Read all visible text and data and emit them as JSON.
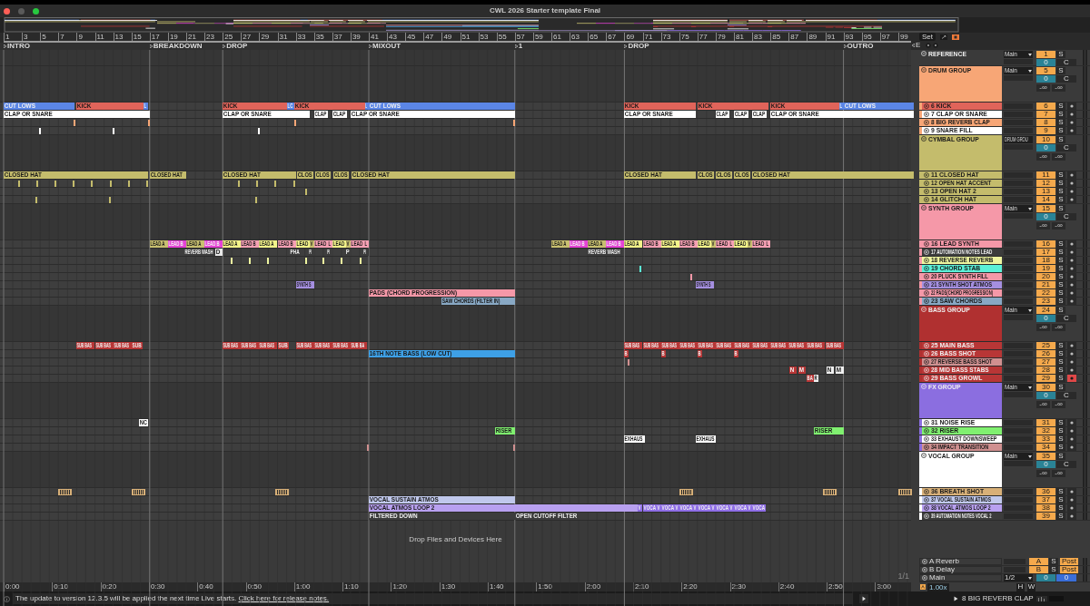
{
  "window": {
    "title": "CWL 2026 Starter template Final"
  },
  "ruler": {
    "bars": [
      "1",
      "3",
      "5",
      "7",
      "9",
      "11",
      "13",
      "15",
      "17",
      "19",
      "21",
      "23",
      "25",
      "27",
      "29",
      "31",
      "33",
      "35",
      "37",
      "39",
      "41",
      "43",
      "45",
      "47",
      "49",
      "51",
      "53",
      "55",
      "57",
      "59",
      "61",
      "63",
      "65",
      "67",
      "69",
      "71",
      "73",
      "75",
      "77",
      "79",
      "81",
      "83",
      "85",
      "87",
      "89",
      "91",
      "93",
      "95",
      "97",
      "99"
    ]
  },
  "set_button": "Set",
  "end_marker": "E",
  "locators": [
    {
      "name": "INTRO"
    },
    {
      "name": "BREAKDOWN"
    },
    {
      "name": "DROP"
    },
    {
      "name": "MIXOUT"
    },
    {
      "name": "1"
    },
    {
      "name": "DROP"
    },
    {
      "name": "OUTRO"
    }
  ],
  "tracks": [
    {
      "kind": "reference",
      "name": "REFERENCE",
      "number": "1",
      "solo": "S",
      "routing": "Main",
      "volume": "0",
      "pan": "C"
    },
    {
      "kind": "group",
      "name": "DRUM GROUP",
      "number": "5",
      "solo": "S",
      "routing": "Main",
      "volume": "0",
      "pan": "C",
      "meters": [
        "-∞",
        "-∞"
      ],
      "color": "#f7a676",
      "children": [
        {
          "kind": "track",
          "name": "6 KICK",
          "number": "6",
          "solo": "S",
          "armed": false,
          "color": "#e0645a",
          "clips": [
            {
              "name": "CUT LOWS",
              "color": "#5b86e6"
            },
            {
              "name": "KICK"
            },
            {
              "name": "L",
              "color": "#5b86e6"
            },
            {
              "name": "KICK"
            },
            {
              "name": "LC",
              "color": "#5b86e6"
            },
            {
              "name": "KICK"
            },
            {
              "name": "L",
              "color": "#5b86e6"
            },
            {
              "name": "CUT LOWS",
              "color": "#5b86e6"
            },
            {
              "name": "KICK"
            },
            {
              "name": "KICK"
            },
            {
              "name": "KICK"
            },
            {
              "name": "L",
              "color": "#5b86e6"
            },
            {
              "name": "CUT LOWS",
              "color": "#5b86e6"
            }
          ]
        },
        {
          "kind": "track",
          "name": "7 CLAP OR SNARE",
          "number": "7",
          "solo": "S",
          "armed": false,
          "color": "#ffffff",
          "clips": [
            {
              "name": "CLAP OR SNARE"
            },
            {
              "name": "CLAP OR SNARE"
            },
            {
              "name": "CLAP"
            },
            {
              "name": "CLAP"
            },
            {
              "name": "CLAP OR SNARE"
            },
            {
              "name": "CLAP OR SNARE"
            },
            {
              "name": "CLAP"
            },
            {
              "name": "CLAP"
            },
            {
              "name": "CLAP"
            },
            {
              "name": "CLAP OR SNARE"
            }
          ]
        },
        {
          "kind": "track",
          "name": "8 BIG REVERB CLAP",
          "number": "8",
          "solo": "S",
          "armed": false,
          "color": "#f7a676"
        },
        {
          "kind": "track",
          "name": "9 SNARE FILL",
          "number": "9",
          "solo": "S",
          "armed": false,
          "color": "#ffffff"
        }
      ]
    },
    {
      "kind": "group",
      "name": "CYMBAL GROUP",
      "number": "10",
      "solo": "S",
      "routing": "DRUM GROU",
      "volume": "0",
      "pan": "C",
      "meters": [
        "-∞",
        "-∞"
      ],
      "color": "#c4bc6c",
      "children": [
        {
          "kind": "track",
          "name": "11 CLOSED HAT",
          "number": "11",
          "solo": "S",
          "armed": false,
          "color": "#c4bc6c",
          "clips": [
            {
              "name": "CLOSED HAT"
            },
            {
              "name": "CLOSED HAT"
            },
            {
              "name": "CLOSED HAT"
            },
            {
              "name": "CLOS"
            },
            {
              "name": "CLOS"
            },
            {
              "name": "CLOS"
            },
            {
              "name": "CLOSED HAT"
            },
            {
              "name": "CLOSED HAT"
            },
            {
              "name": "CLOS"
            },
            {
              "name": "CLOS"
            },
            {
              "name": "CLOS"
            },
            {
              "name": "CLOSED HAT"
            }
          ]
        },
        {
          "kind": "track",
          "name": "12 OPEN HAT ACCENT",
          "number": "12",
          "solo": "S",
          "armed": false,
          "color": "#c4bc6c"
        },
        {
          "kind": "track",
          "name": "13 OPEN HAT 2",
          "number": "13",
          "solo": "S",
          "armed": false,
          "color": "#c4bc6c"
        },
        {
          "kind": "track",
          "name": "14 GLITCH HAT",
          "number": "14",
          "solo": "S",
          "armed": false,
          "color": "#c4bc6c"
        }
      ]
    },
    {
      "kind": "group",
      "name": "SYNTH GROUP",
      "number": "15",
      "solo": "S",
      "routing": "Main",
      "volume": "0",
      "pan": "C",
      "meters": [
        "-∞",
        "-∞"
      ],
      "color": "#f598a8",
      "children": [
        {
          "kind": "track",
          "name": "16 LEAD SYNTH",
          "number": "16",
          "solo": "S",
          "armed": false,
          "color": "#f598a8",
          "clips": [
            {
              "name": "LEAD A",
              "color": "#c8c070"
            },
            {
              "name": "LEAD B",
              "color": "#e543d6"
            },
            {
              "name": "LEAD A",
              "color": "#c8c070"
            },
            {
              "name": "LEAD B",
              "color": "#e543d6"
            },
            {
              "name": "LEAD A",
              "color": "#f3f48a"
            },
            {
              "name": "LEAD B",
              "color": "#f6a0b4"
            },
            {
              "name": "LEAD A",
              "color": "#f3f48a"
            },
            {
              "name": "LEAD B",
              "color": "#f6a0b4"
            },
            {
              "name": "LEAD",
              "color": "#f3f48a"
            },
            {
              "name": "V",
              "color": "#c8c070"
            },
            {
              "name": "LEAD",
              "color": "#f6a0b4"
            },
            {
              "name": "L",
              "color": "#f6a0b4"
            },
            {
              "name": "LEAD",
              "color": "#f3f48a"
            },
            {
              "name": "V",
              "color": "#c8c070"
            },
            {
              "name": "LEAD",
              "color": "#f6a0b4"
            },
            {
              "name": "L",
              "color": "#f6a0b4"
            },
            {
              "name": "LEAD A",
              "color": "#c8c070"
            },
            {
              "name": "LEAD B",
              "color": "#e543d6"
            },
            {
              "name": "LEAD A",
              "color": "#c8c070"
            },
            {
              "name": "LEAD B",
              "color": "#e543d6"
            },
            {
              "name": "LEAD A",
              "color": "#f3f48a"
            },
            {
              "name": "LEAD B",
              "color": "#f6a0b4"
            },
            {
              "name": "LEAD A",
              "color": "#f3f48a"
            },
            {
              "name": "LEAD B",
              "color": "#f6a0b4"
            },
            {
              "name": "LEAD",
              "color": "#f3f48a"
            },
            {
              "name": "V",
              "color": "#c8c070"
            },
            {
              "name": "LEAD",
              "color": "#f6a0b4"
            },
            {
              "name": "L",
              "color": "#f6a0b4"
            },
            {
              "name": "LEAD",
              "color": "#f3f48a"
            },
            {
              "name": "V",
              "color": "#c8c070"
            },
            {
              "name": "LEAD",
              "color": "#f6a0b4"
            },
            {
              "name": "L",
              "color": "#f6a0b4"
            }
          ]
        },
        {
          "kind": "track",
          "name": "17 AUTOMATION NOTES LEAD",
          "number": "17",
          "solo": "S",
          "armed": false,
          "color": "#3c3c3c",
          "clips": [
            {
              "name": "REVERB WASH"
            },
            {
              "name": "D",
              "color": "#e8e8e8"
            },
            {
              "name": "PHA"
            },
            {
              "name": "PI"
            },
            {
              "name": "PI"
            },
            {
              "name": "P"
            },
            {
              "name": "PI"
            },
            {
              "name": "REVERB WASH"
            }
          ]
        },
        {
          "kind": "track",
          "name": "18 REVERSE REVERB",
          "number": "18",
          "solo": "S",
          "armed": false,
          "color": "#eef5a0"
        },
        {
          "kind": "track",
          "name": "19 CHORD STAB",
          "number": "19",
          "solo": "S",
          "armed": false,
          "color": "#5af0d8"
        },
        {
          "kind": "track",
          "name": "20 PLUCK SYNTH FILL",
          "number": "20",
          "solo": "S",
          "armed": false,
          "color": "#f598a8"
        },
        {
          "kind": "track",
          "name": "21 SYNTH SHOT ATMOS",
          "number": "21",
          "solo": "S",
          "armed": false,
          "color": "#a58fe0",
          "clips": [
            {
              "name": "SYNTH S"
            },
            {
              "name": "SYNTH S"
            }
          ]
        },
        {
          "kind": "track",
          "name": "22 PADS(CHORD PROGRESSION)",
          "number": "22",
          "solo": "S",
          "armed": false,
          "color": "#f598a8",
          "clips": [
            {
              "name": "PADS (CHORD PROGRESSION)"
            }
          ]
        },
        {
          "kind": "track",
          "name": "23 SAW CHORDS",
          "number": "23",
          "solo": "S",
          "armed": false,
          "color": "#88a8c4",
          "clips": [
            {
              "name": "SAW CHORDS (FILTER IN)"
            }
          ]
        }
      ]
    },
    {
      "kind": "group",
      "name": "BASS GROUP",
      "number": "24",
      "solo": "S",
      "routing": "Main",
      "volume": "0",
      "pan": "C",
      "meters": [
        "-∞",
        "-∞"
      ],
      "color": "#b03030",
      "children": [
        {
          "kind": "track",
          "name": "25 MAIN BASS",
          "number": "25",
          "solo": "S",
          "armed": false,
          "color": "#b83636",
          "clips": [
            {
              "name": "SUB BAS"
            },
            {
              "name": "SUB BAS"
            },
            {
              "name": "SUB BAS"
            },
            {
              "name": "SUB"
            },
            {
              "name": "SUB BAS"
            },
            {
              "name": "SUB BAS"
            },
            {
              "name": "SUB BAS"
            },
            {
              "name": "SUB"
            },
            {
              "name": "SUB BAS"
            },
            {
              "name": "SUB BAS"
            },
            {
              "name": "SUB BAS"
            },
            {
              "name": "SUB BA"
            },
            {
              "name": "SUB BAS"
            },
            {
              "name": "SUB BAS"
            },
            {
              "name": "SUB BAS"
            },
            {
              "name": "SUB BAS"
            },
            {
              "name": "SUB BAS"
            },
            {
              "name": "SUB BAS"
            },
            {
              "name": "SUB BAS"
            },
            {
              "name": "SUB BAS"
            },
            {
              "name": "SUB BAS"
            },
            {
              "name": "SUB BAS"
            },
            {
              "name": "SUB BAS"
            },
            {
              "name": "SUB BAS"
            }
          ]
        },
        {
          "kind": "track",
          "name": "26 BASS SHOT",
          "number": "26",
          "solo": "S",
          "armed": false,
          "color": "#b83636",
          "clips": [
            {
              "name": "16TH NOTE BASS (LOW CUT)",
              "color": "#3ea0e6"
            },
            {
              "name": "B"
            },
            {
              "name": "B"
            },
            {
              "name": "B"
            },
            {
              "name": "B"
            }
          ]
        },
        {
          "kind": "track",
          "name": "27 REVERSE BASS SHOT",
          "number": "27",
          "solo": "S",
          "armed": false,
          "color": "#d09090"
        },
        {
          "kind": "track",
          "name": "28 MID BASS STABS",
          "number": "28",
          "solo": "S",
          "armed": false,
          "color": "#b83636",
          "clips": [
            {
              "name": "N"
            },
            {
              "name": "M"
            },
            {
              "name": "N",
              "color": "#f0f0f0"
            },
            {
              "name": "M",
              "color": "#f0f0f0"
            }
          ]
        },
        {
          "kind": "track",
          "name": "29 BASS GROWL",
          "number": "29",
          "solo": "S",
          "armed": true,
          "color": "#b83636",
          "clips": [
            {
              "name": "BA"
            },
            {
              "name": "R",
              "color": "#f0f0f0"
            }
          ]
        }
      ]
    },
    {
      "kind": "group",
      "name": "FX GROUP",
      "number": "30",
      "solo": "S",
      "routing": "Main",
      "volume": "0",
      "pan": "C",
      "meters": [
        "-∞",
        "-∞"
      ],
      "color": "#8b6ee0",
      "children": [
        {
          "kind": "track",
          "name": "31 NOISE RISE",
          "number": "31",
          "solo": "S",
          "armed": false,
          "color": "#ffffff",
          "clips": [
            {
              "name": "NC"
            }
          ]
        },
        {
          "kind": "track",
          "name": "32 RISER",
          "number": "32",
          "solo": "S",
          "armed": false,
          "color": "#80f070",
          "clips": [
            {
              "name": "RISER"
            },
            {
              "name": "RISER"
            }
          ]
        },
        {
          "kind": "track",
          "name": "33 EXHAUST DOWNSWEEP",
          "number": "33",
          "solo": "S",
          "armed": false,
          "color": "#ffffff",
          "clips": [
            {
              "name": "EXHAUS"
            },
            {
              "name": "EXHAUS"
            }
          ]
        },
        {
          "kind": "track",
          "name": "34 IMPACT TRANSITION",
          "number": "34",
          "solo": "S",
          "armed": false,
          "color": "#d09090"
        }
      ]
    },
    {
      "kind": "group",
      "name": "VOCAL GROUP",
      "number": "35",
      "solo": "S",
      "routing": "Main",
      "volume": "0",
      "pan": "C",
      "meters": [
        "-∞",
        "-∞"
      ],
      "color": "#ffffff",
      "children": [
        {
          "kind": "track",
          "name": "36 BREATH SHOT",
          "number": "36",
          "solo": "S",
          "armed": false,
          "color": "#d8b078"
        },
        {
          "kind": "track",
          "name": "37 VOCAL SUSTAIN ATMOS",
          "number": "37",
          "solo": "S",
          "armed": false,
          "color": "#c0c8ec",
          "clips": [
            {
              "name": "VOCAL SUSTAIN ATMOS"
            }
          ]
        },
        {
          "kind": "track",
          "name": "38 VOCAL ATMOS LOOP 2",
          "number": "38",
          "solo": "S",
          "armed": false,
          "color": "#b8a0f0",
          "clips": [
            {
              "name": "VOCAL ATMOS LOOP 2"
            },
            {
              "name": "V",
              "color": "#8f6ee6"
            },
            {
              "name": "VOCA",
              "color": "#8f6ee6"
            },
            {
              "name": "V",
              "color": "#8f6ee6"
            },
            {
              "name": "VOCA",
              "color": "#8f6ee6"
            },
            {
              "name": "V",
              "color": "#8f6ee6"
            },
            {
              "name": "VOCA",
              "color": "#8f6ee6"
            },
            {
              "name": "V",
              "color": "#8f6ee6"
            },
            {
              "name": "VOCA",
              "color": "#8f6ee6"
            },
            {
              "name": "V",
              "color": "#8f6ee6"
            },
            {
              "name": "VOCA",
              "color": "#8f6ee6"
            },
            {
              "name": "V",
              "color": "#8f6ee6"
            },
            {
              "name": "VOCA",
              "color": "#8f6ee6"
            },
            {
              "name": "V",
              "color": "#8f6ee6"
            },
            {
              "name": "VOCA",
              "color": "#8f6ee6"
            }
          ]
        },
        {
          "kind": "track",
          "name": "39 AUTOMATION NOTES VOCAL 2",
          "number": "39",
          "solo": "S",
          "armed": false,
          "color": "#3c3c3c",
          "clips": [
            {
              "name": "FILTERED DOWN"
            },
            {
              "name": "OPEN CUTOFF FILTER"
            }
          ]
        }
      ]
    }
  ],
  "drop_hint": "Drop Files and Devices Here",
  "zoom_readout": "1/1",
  "returns": [
    {
      "name": "A Reverb",
      "letter": "A",
      "solo": "S",
      "mode": "Post"
    },
    {
      "name": "B Delay",
      "letter": "B",
      "solo": "S",
      "mode": "Post"
    }
  ],
  "main": {
    "name": "Main",
    "routing": "1/2",
    "volume": "0",
    "pan": "0"
  },
  "time_ruler": [
    "0:00",
    "0:10",
    "0:20",
    "0:30",
    "0:40",
    "0:50",
    "1:00",
    "1:10",
    "1:20",
    "1:30",
    "1:40",
    "1:50",
    "2:00",
    "2:10",
    "2:20",
    "2:30",
    "2:40",
    "2:50",
    "3:00"
  ],
  "tempo_scale": "1.00x",
  "toggles": [
    "H",
    "W"
  ],
  "status": {
    "message": "The update to version 12.3.5 will be applied the next time Live starts.",
    "link": "Click here for release notes."
  },
  "selected_clip": "8 BIG REVERB CLAP"
}
